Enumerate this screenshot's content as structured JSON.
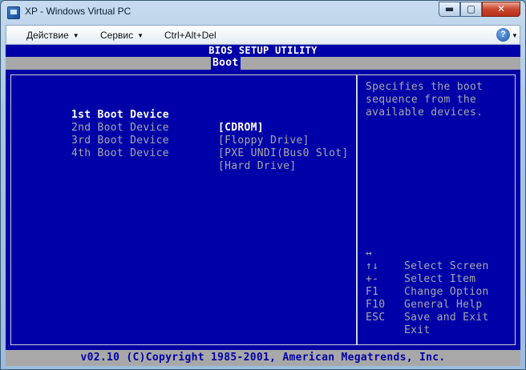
{
  "window": {
    "title": "XP - Windows Virtual PC",
    "minimize_glyph": "▬",
    "maximize_glyph": "▢",
    "close_glyph": "✕"
  },
  "menubar": {
    "items": [
      {
        "label": "Действие"
      },
      {
        "label": "Сервис"
      },
      {
        "label": "Ctrl+Alt+Del"
      }
    ],
    "help_glyph": "?"
  },
  "bios": {
    "title": "BIOS SETUP UTILITY",
    "active_tab": "Boot",
    "boot_devices": [
      {
        "label": "1st Boot Device",
        "value": "[CDROM]"
      },
      {
        "label": "2nd Boot Device",
        "value": "[Floppy Drive]"
      },
      {
        "label": "3rd Boot Device",
        "value": "[PXE UNDI(Bus0 Slot]"
      },
      {
        "label": "4th Boot Device",
        "value": "[Hard Drive]"
      }
    ],
    "help_lines": [
      "Specifies the boot",
      "sequence from the",
      "available devices."
    ],
    "keys": [
      {
        "key": "↔",
        "desc": "Select Screen"
      },
      {
        "key": "↑↓",
        "desc": "Select Item"
      },
      {
        "key": "+-",
        "desc": "Change Option"
      },
      {
        "key": "F1",
        "desc": "General Help"
      },
      {
        "key": "F10",
        "desc": "Save and Exit"
      },
      {
        "key": "ESC",
        "desc": "Exit"
      }
    ],
    "footer": "v02.10 (C)Copyright 1985-2001, American Megatrends, Inc."
  },
  "colors": {
    "bios_blue": "#0000a8",
    "bios_gray": "#a8a8a8",
    "bios_white": "#ffffff",
    "close_red": "#c9462c"
  }
}
